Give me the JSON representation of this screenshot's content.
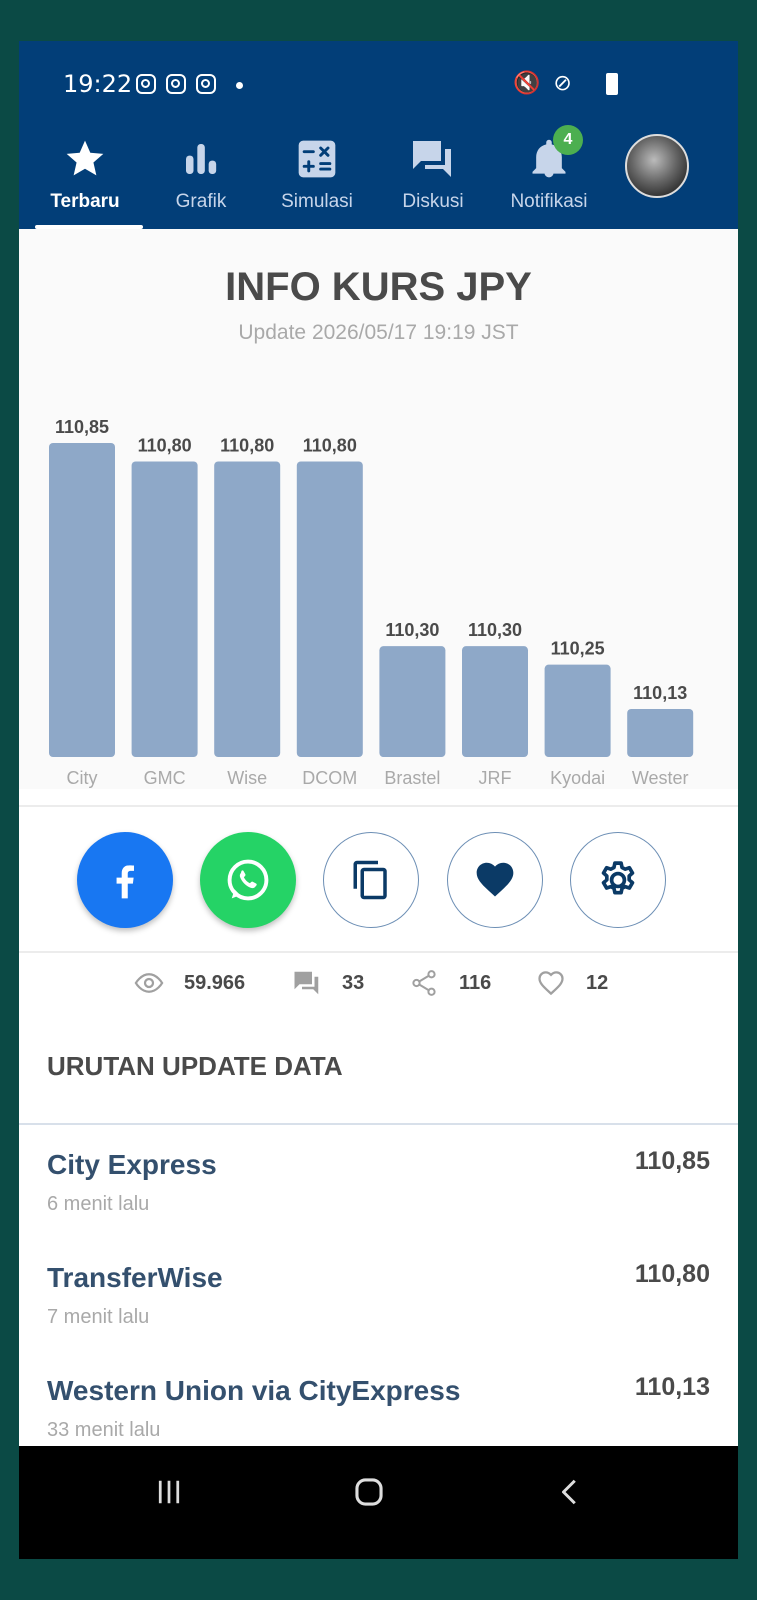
{
  "status_bar": {
    "time": "19:22",
    "right_icons": "🔇 ⊘"
  },
  "nav": {
    "tabs": [
      {
        "label": "Terbaru",
        "icon": "star-icon",
        "active": true
      },
      {
        "label": "Grafik",
        "icon": "bar-chart-icon",
        "active": false
      },
      {
        "label": "Simulasi",
        "icon": "calculator-icon",
        "active": false
      },
      {
        "label": "Diskusi",
        "icon": "chat-icon",
        "active": false
      },
      {
        "label": "Notifikasi",
        "icon": "bell-icon",
        "active": false,
        "badge": "4"
      }
    ]
  },
  "chart_data": {
    "type": "bar",
    "title": "INFO KURS JPY",
    "subtitle": "Update 2026/05/17 19:19 JST",
    "categories": [
      "City",
      "GMC",
      "Wise",
      "DCOM",
      "Brastel",
      "JRF",
      "Kyodai",
      "Western City"
    ],
    "category_label_lines": [
      [
        "City"
      ],
      [
        "GMC"
      ],
      [
        "Wise"
      ],
      [
        "DCOM"
      ],
      [
        "Brastel"
      ],
      [
        "JRF"
      ],
      [
        "Kyodai"
      ],
      [
        "Wester",
        "n City"
      ]
    ],
    "values": [
      110.85,
      110.8,
      110.8,
      110.8,
      110.3,
      110.3,
      110.25,
      110.13
    ],
    "value_labels": [
      "110,85",
      "110,80",
      "110,80",
      "110,80",
      "110,30",
      "110,30",
      "110,25",
      "110,13"
    ],
    "ylim": [
      110.0,
      110.85
    ],
    "bar_color": "#8ea8c8",
    "grid": false
  },
  "share": {
    "buttons": [
      {
        "icon": "facebook-icon",
        "color": "#1877f2"
      },
      {
        "icon": "whatsapp-icon",
        "color": "#25d366"
      },
      {
        "icon": "copy-icon",
        "color": "#023e78"
      },
      {
        "icon": "heart-icon",
        "color": "#023e78"
      },
      {
        "icon": "gear-icon",
        "color": "#023e78"
      }
    ]
  },
  "stats": {
    "views": "59.966",
    "comments": "33",
    "shares": "116",
    "likes": "12"
  },
  "list": {
    "header": "URUTAN UPDATE DATA",
    "items": [
      {
        "name": "City Express",
        "ago": "6 menit lalu",
        "value": "110,85"
      },
      {
        "name": "TransferWise",
        "ago": "7 menit lalu",
        "value": "110,80"
      },
      {
        "name": "Western Union via CityExpress",
        "ago": "33 menit lalu",
        "value": "110,13"
      }
    ]
  },
  "colors": {
    "header_bg": "#023e78",
    "accent": "#34506e",
    "badge": "#4caf50"
  }
}
